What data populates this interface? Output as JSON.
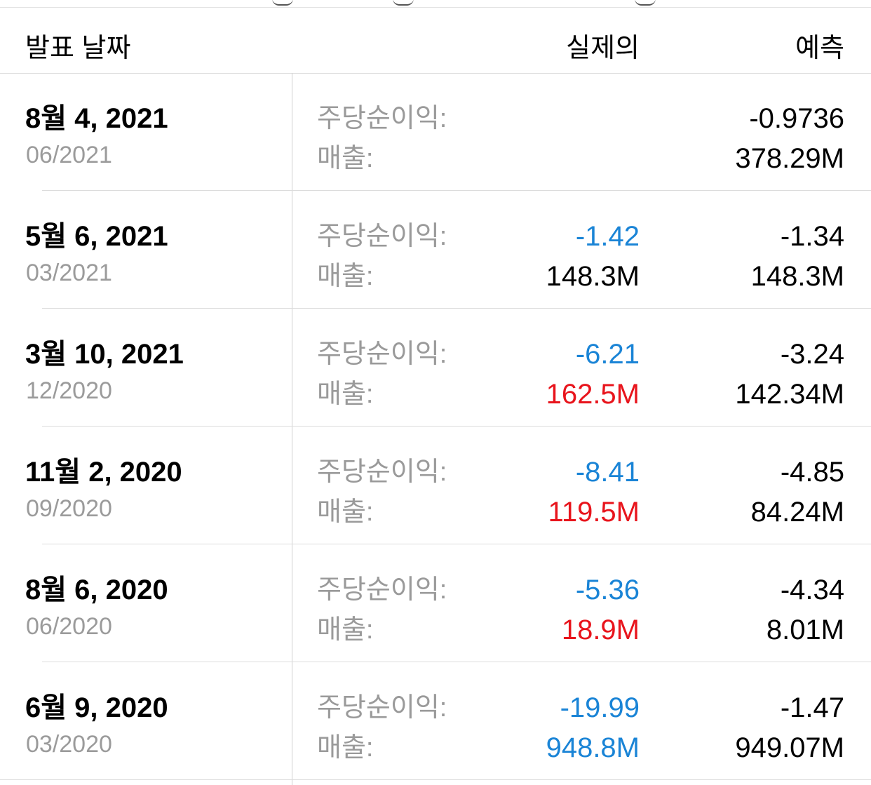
{
  "colors": {
    "blue": "#1a84d6",
    "red": "#e8141c",
    "black": "#000000",
    "gray": "#9a9a9a"
  },
  "header": {
    "date_label": "발표 날짜",
    "actual_label": "실제의",
    "forecast_label": "예측"
  },
  "rows": [
    {
      "date": "8월 4, 2021",
      "period": "06/2021",
      "eps_label": "주당순이익:",
      "revenue_label": "매출:",
      "eps_actual": "",
      "eps_actual_color": "#000000",
      "revenue_actual": "",
      "revenue_actual_color": "#000000",
      "eps_forecast": "-0.9736",
      "revenue_forecast": "378.29M"
    },
    {
      "date": "5월 6, 2021",
      "period": "03/2021",
      "eps_label": "주당순이익:",
      "revenue_label": "매출:",
      "eps_actual": "-1.42",
      "eps_actual_color": "#1a84d6",
      "revenue_actual": "148.3M",
      "revenue_actual_color": "#000000",
      "eps_forecast": "-1.34",
      "revenue_forecast": "148.3M"
    },
    {
      "date": "3월 10, 2021",
      "period": "12/2020",
      "eps_label": "주당순이익:",
      "revenue_label": "매출:",
      "eps_actual": "-6.21",
      "eps_actual_color": "#1a84d6",
      "revenue_actual": "162.5M",
      "revenue_actual_color": "#e8141c",
      "eps_forecast": "-3.24",
      "revenue_forecast": "142.34M"
    },
    {
      "date": "11월 2, 2020",
      "period": "09/2020",
      "eps_label": "주당순이익:",
      "revenue_label": "매출:",
      "eps_actual": "-8.41",
      "eps_actual_color": "#1a84d6",
      "revenue_actual": "119.5M",
      "revenue_actual_color": "#e8141c",
      "eps_forecast": "-4.85",
      "revenue_forecast": "84.24M"
    },
    {
      "date": "8월 6, 2020",
      "period": "06/2020",
      "eps_label": "주당순이익:",
      "revenue_label": "매출:",
      "eps_actual": "-5.36",
      "eps_actual_color": "#1a84d6",
      "revenue_actual": "18.9M",
      "revenue_actual_color": "#e8141c",
      "eps_forecast": "-4.34",
      "revenue_forecast": "8.01M"
    },
    {
      "date": "6월 9, 2020",
      "period": "03/2020",
      "eps_label": "주당순이익:",
      "revenue_label": "매출:",
      "eps_actual": "-19.99",
      "eps_actual_color": "#1a84d6",
      "revenue_actual": "948.8M",
      "revenue_actual_color": "#1a84d6",
      "eps_forecast": "-1.47",
      "revenue_forecast": "949.07M"
    }
  ]
}
